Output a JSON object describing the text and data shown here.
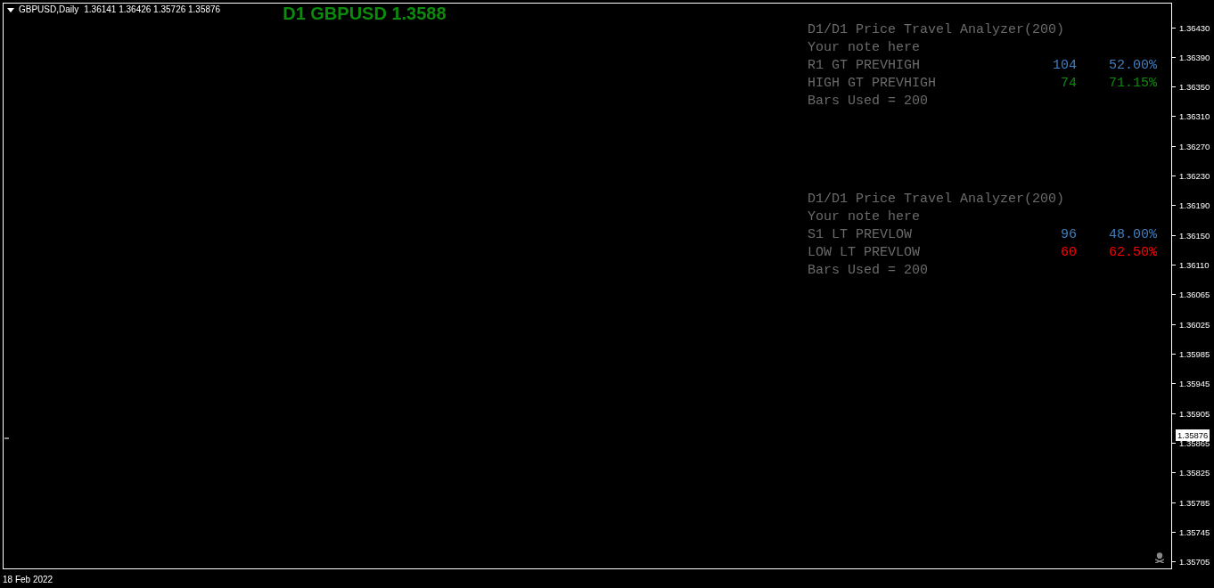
{
  "chart": {
    "symbol": "GBPUSD,Daily",
    "ohlc": "1.36141 1.36426 1.35726 1.35876",
    "headline": "D1 GBPUSD 1.3588",
    "panels": [
      {
        "title": "D1/D1 Price Travel Analyzer(200)",
        "note": "Your note here",
        "rows": [
          {
            "label": "R1 GT PREVHIGH",
            "count": "104",
            "percent": "52.00%",
            "color": "#3f7fbf"
          },
          {
            "label": "HIGH GT PREVHIGH",
            "count": "74",
            "percent": "71.15%",
            "color": "#0b8a0b"
          }
        ],
        "footer": "Bars Used = 200"
      },
      {
        "title": "D1/D1 Price Travel Analyzer(200)",
        "note": "Your note here",
        "rows": [
          {
            "label": "S1 LT PREVLOW",
            "count": "96",
            "percent": "48.00%",
            "color": "#3f7fbf"
          },
          {
            "label": "LOW LT PREVLOW",
            "count": "60",
            "percent": "62.50%",
            "color": "#ff0000"
          }
        ],
        "footer": "Bars Used = 200"
      }
    ]
  },
  "price_axis": {
    "ticks": [
      "1.36430",
      "1.36390",
      "1.36350",
      "1.36310",
      "1.36270",
      "1.36230",
      "1.36190",
      "1.36150",
      "1.36110",
      "1.36065",
      "1.36025",
      "1.35985",
      "1.35945",
      "1.35905",
      "1.35865",
      "1.35825",
      "1.35785",
      "1.35745",
      "1.35705"
    ],
    "current_price": "1.35876"
  },
  "time_axis": {
    "labels": [
      "18 Feb 2022"
    ]
  }
}
